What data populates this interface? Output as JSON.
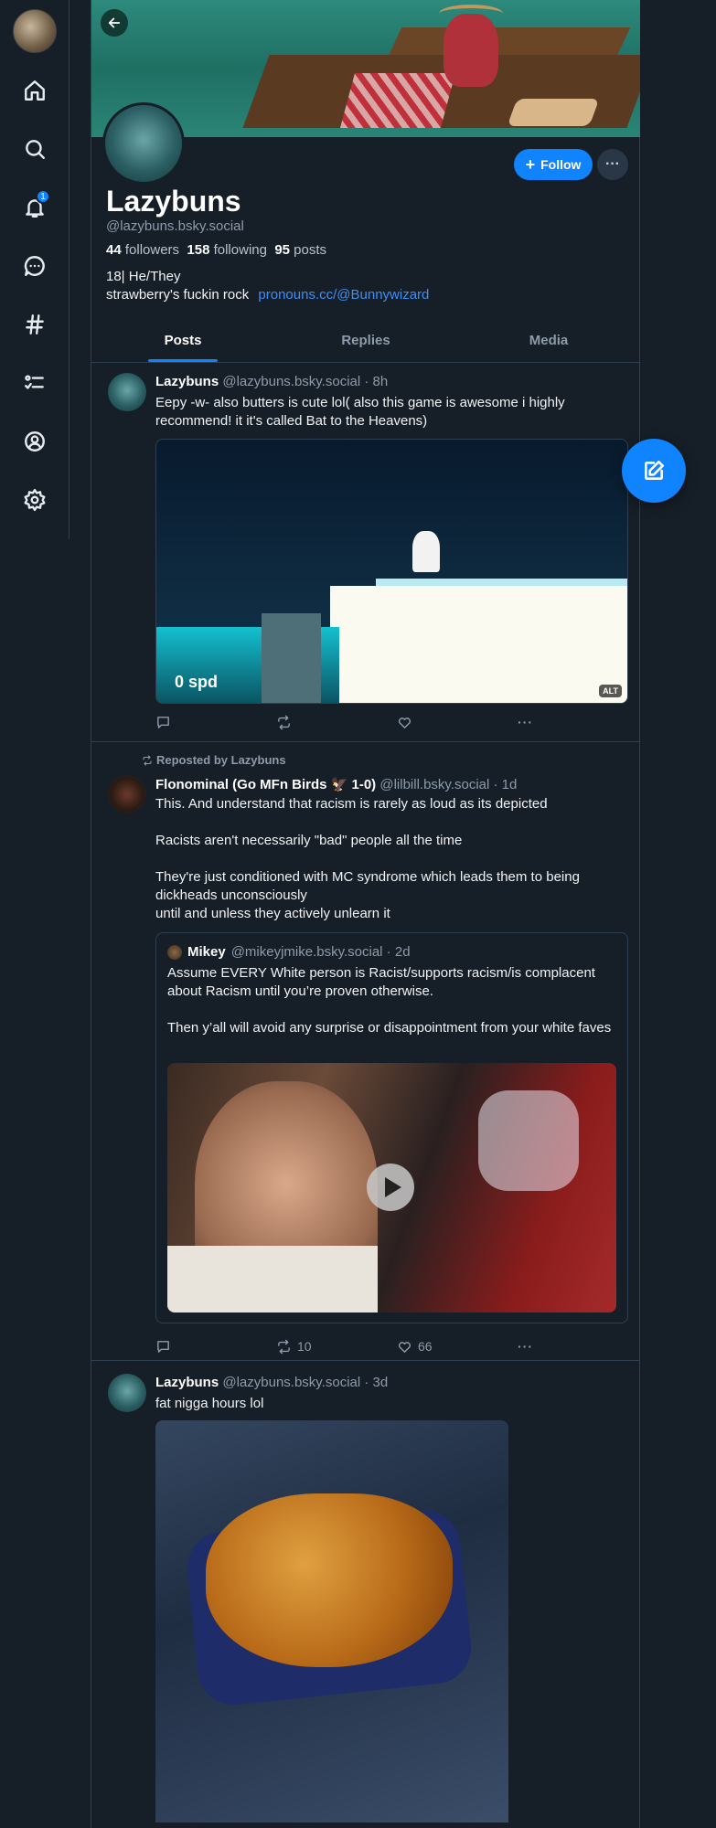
{
  "nav": {
    "notifications_badge": "1",
    "items": [
      "home-icon",
      "search-icon",
      "bell-icon",
      "chat-icon",
      "hashtag-icon",
      "list-icon",
      "profile-icon",
      "gear-icon"
    ]
  },
  "profile": {
    "display_name": "Lazybuns",
    "handle": "@lazybuns.bsky.social",
    "followers_count": "44",
    "followers_label": "followers",
    "following_count": "158",
    "following_label": "following",
    "posts_count": "95",
    "posts_label": "posts",
    "bio_line1": "18| He/They",
    "bio_line2": "strawberry's fuckin rock",
    "bio_link": "pronouns.cc/@Bunnywizard",
    "follow_label": "Follow",
    "more_label": "···"
  },
  "tabs": [
    "Posts",
    "Replies",
    "Media"
  ],
  "posts": [
    {
      "author": "Lazybuns",
      "handle": "@lazybuns.bsky.social · 8h",
      "text": "Eepy -w- also butters is cute lol( also this game is awesome i highly recommend! it it's called Bat to the Heavens)",
      "image_text": "0 spd",
      "alt_badge": "ALT",
      "replies": "",
      "reposts": "",
      "likes": ""
    },
    {
      "repost_label": "Reposted by Lazybuns",
      "author": "Flonominal (Go MFn Birds 🦅 1-0)",
      "handle": "@lilbill.bsky.social · 1d",
      "text": "This. And understand that racism is rarely as loud as its depicted\n\nRacists aren't necessarily \"bad\" people all the time\n\nThey're just conditioned with MC syndrome which leads them to being dickheads unconsciously\nuntil and unless they actively unlearn it",
      "quote": {
        "author": "Mikey",
        "handle": "@mikeyjmike.bsky.social · 2d",
        "text": "Assume EVERY White person is Racist/supports racism/is complacent about Racism until you’re proven otherwise.\n\nThen y’all will avoid any surprise or disappointment from your white faves"
      },
      "replies": "",
      "reposts": "10",
      "likes": "66"
    },
    {
      "author": "Lazybuns",
      "handle": "@lazybuns.bsky.social · 3d",
      "text": "fat nigga hours lol"
    }
  ],
  "colors": {
    "background": "#161e27",
    "accent": "#1083fe",
    "muted": "#8d9bab",
    "border": "#2e4052"
  }
}
